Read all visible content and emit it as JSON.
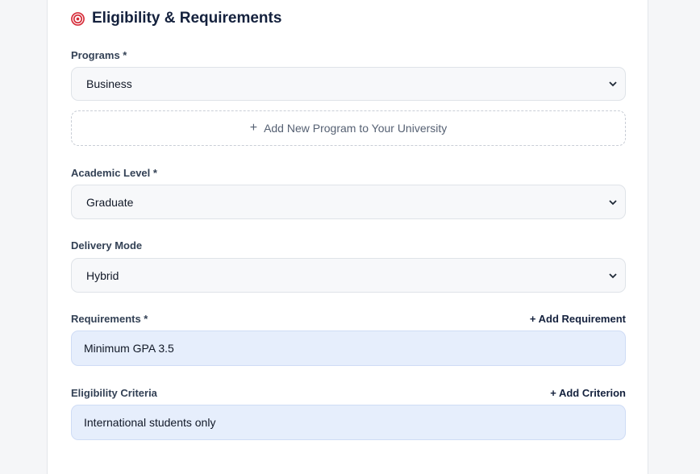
{
  "section": {
    "title": "Eligibility & Requirements",
    "icon": "target-icon",
    "accent": "#d62d3a"
  },
  "programs": {
    "label": "Programs *",
    "selected": "Business",
    "add_button": "Add New Program to Your University"
  },
  "academic_level": {
    "label": "Academic Level *",
    "selected": "Graduate"
  },
  "delivery_mode": {
    "label": "Delivery Mode",
    "selected": "Hybrid"
  },
  "requirements": {
    "label": "Requirements *",
    "add_link": "+ Add Requirement",
    "items": [
      "Minimum GPA 3.5"
    ]
  },
  "eligibility": {
    "label": "Eligibility Criteria",
    "add_link": "+ Add Criterion",
    "items": [
      "International students only"
    ]
  }
}
